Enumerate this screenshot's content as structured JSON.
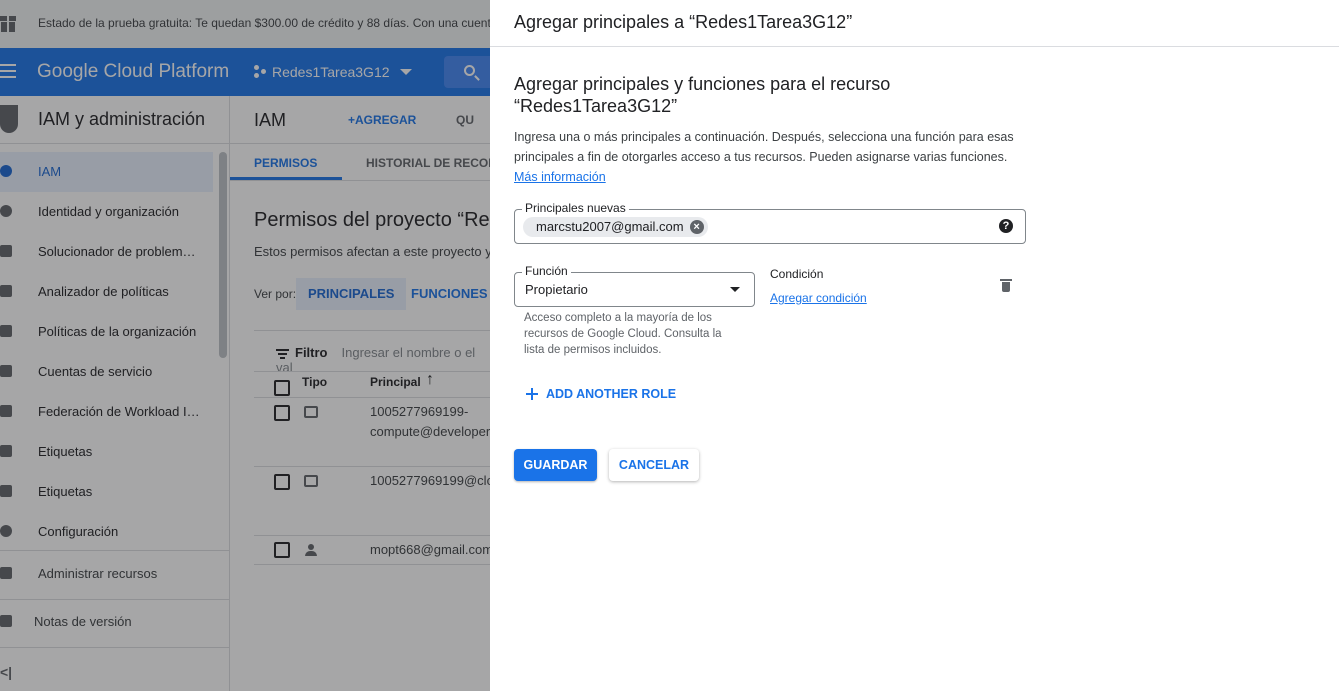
{
  "trial_banner": {
    "text": "Estado de la prueba gratuita: Te quedan $300.00 de crédito y 88 días. Con una cuenta"
  },
  "topbar": {
    "brand": "Google Cloud Platform",
    "project": "Redes1Tarea3G12"
  },
  "sidebar": {
    "title": "IAM y administración",
    "items": [
      {
        "label": "IAM",
        "icon": "person-add-icon",
        "active": true
      },
      {
        "label": "Identidad y organización",
        "icon": "account-circle-icon"
      },
      {
        "label": "Solucionador de problem…",
        "icon": "wrench-icon"
      },
      {
        "label": "Analizador de políticas",
        "icon": "policy-search-icon"
      },
      {
        "label": "Políticas de la organización",
        "icon": "document-icon"
      },
      {
        "label": "Cuentas de servicio",
        "icon": "service-account-icon"
      },
      {
        "label": "Federación de Workload I…",
        "icon": "id-card-icon"
      },
      {
        "label": "Etiquetas",
        "icon": "tag-icon"
      },
      {
        "label": "Etiquetas",
        "icon": "label-icon"
      },
      {
        "label": "Configuración",
        "icon": "gear-icon"
      }
    ],
    "manage": "Administrar recursos",
    "notes": "Notas de versión",
    "collapse": "<|"
  },
  "main": {
    "title": "IAM",
    "add": "AGREGAR",
    "remove": "QU",
    "tabs": [
      "PERMISOS",
      "HISTORIAL DE RECOM"
    ],
    "page_title": "Permisos del proyecto “Re",
    "page_desc": "Estos permisos afectan a este proyecto y",
    "view_by": "Ver por:",
    "view_principals": "PRINCIPALES",
    "view_roles": "FUNCIONES",
    "filter_label": "Filtro",
    "filter_placeholder": "Ingresar el nombre o el val",
    "col_type": "Tipo",
    "col_principal": "Principal",
    "rows": [
      {
        "line1": "1005277969199-",
        "line2": "compute@developer"
      },
      {
        "line1": "1005277969199@clo",
        "line2": ""
      },
      {
        "line1": "mopt668@gmail.com",
        "line2": ""
      }
    ]
  },
  "panel": {
    "title": "Agregar principales a “Redes1Tarea3G12”",
    "heading": "Agregar principales y funciones para el recurso “Redes1Tarea3G12”",
    "intro": "Ingresa una o más principales a continuación. Después, selecciona una función para esas principales a fin de otorgarles acceso a tus recursos. Pueden asignarse varias funciones.",
    "more_info": "Más información",
    "principals_label": "Principales nuevas",
    "principal_chip": "marcstu2007@gmail.com",
    "role_label": "Función",
    "role_value": "Propietario",
    "role_help": "Acceso completo a la mayoría de los recursos de Google Cloud. Consulta la lista de permisos incluidos.",
    "condition_title": "Condición",
    "condition_link": "Agregar condición",
    "add_role": "ADD ANOTHER ROLE",
    "save": "GUARDAR",
    "cancel": "CANCELAR"
  },
  "colors": {
    "accent": "#1a73e8",
    "scrim": "rgba(32,33,36,0.4)"
  }
}
